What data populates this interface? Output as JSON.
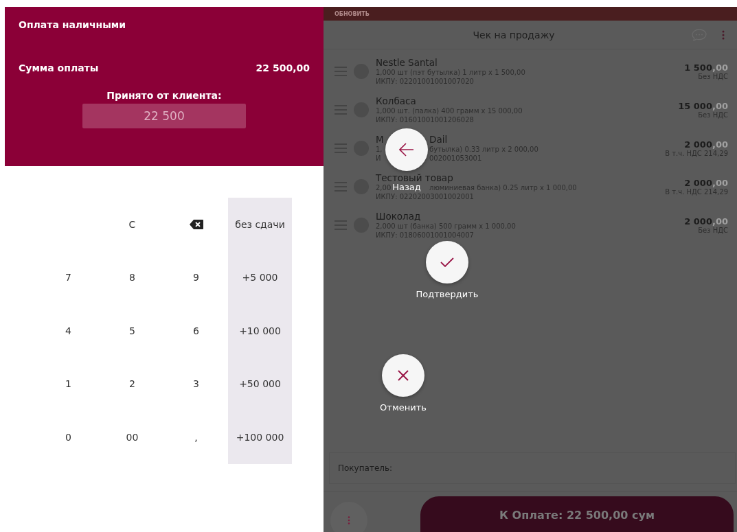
{
  "payment": {
    "title": "Оплата наличными",
    "sum_label": "Сумма оплаты",
    "sum_value": "22 500,00",
    "received_label": "Принято от клиента:",
    "received_value": "22 500"
  },
  "keypad": [
    {
      "kind": "blank"
    },
    {
      "kind": "key",
      "label": "C"
    },
    {
      "kind": "backspace"
    },
    {
      "kind": "quick",
      "label": "без сдачи"
    },
    {
      "kind": "key",
      "label": "7"
    },
    {
      "kind": "key",
      "label": "8"
    },
    {
      "kind": "key",
      "label": "9"
    },
    {
      "kind": "quick",
      "label": "+5 000"
    },
    {
      "kind": "key",
      "label": "4"
    },
    {
      "kind": "key",
      "label": "5"
    },
    {
      "kind": "key",
      "label": "6"
    },
    {
      "kind": "quick",
      "label": "+10 000"
    },
    {
      "kind": "key",
      "label": "1"
    },
    {
      "kind": "key",
      "label": "2"
    },
    {
      "kind": "key",
      "label": "3"
    },
    {
      "kind": "quick",
      "label": "+50 000"
    },
    {
      "kind": "key",
      "label": "0"
    },
    {
      "kind": "key",
      "label": "00"
    },
    {
      "kind": "key",
      "label": ","
    },
    {
      "kind": "quick",
      "label": "+100 000"
    }
  ],
  "receipt": {
    "refresh": "ОБНОВИТЬ",
    "title": "Чек на продажу",
    "items": [
      {
        "name": [
          "Nestle Santal"
        ],
        "detail": [
          "1,000 шт (пэт бутылка) 1 литр x 1 500,00"
        ],
        "code": [
          "ИКПУ: 02201001001007020"
        ],
        "amount": "1 500",
        "cents": ",00",
        "vat": "Без НДС"
      },
      {
        "name": [
          "Колбаса"
        ],
        "detail": [
          "1,000 шт. (палка) 400 грамм x 15 000,00"
        ],
        "code": [
          "ИКПУ: 01601001001206028"
        ],
        "amount": "15 000",
        "cents": ",00",
        "vat": "Без НДС"
      },
      {
        "name": [
          "M",
          "Dail"
        ],
        "detail": [
          "1,",
          "бутылка) 0.33 литр x 2 000,00"
        ],
        "code": [
          "И",
          "002001053001"
        ],
        "amount": "2 000",
        "cents": ",00",
        "vat": "В т.ч. НДС 214,29"
      },
      {
        "name": [
          "Тестовый товар"
        ],
        "detail": [
          "2,00",
          "люминиевая банка) 0.25 литр x 1 000,00"
        ],
        "code": [
          "ИКПУ: 02202003001002001"
        ],
        "amount": "2 000",
        "cents": ",00",
        "vat": "В т.ч. НДС 214,29"
      },
      {
        "name": [
          "Шоколад"
        ],
        "detail": [
          "2,000 шт (банка) 500 грамм x 1 000,00"
        ],
        "code": [
          "ИКПУ: 01806001001004007"
        ],
        "amount": "2 000",
        "cents": ",00",
        "vat": "Без НДС"
      }
    ],
    "customer_label": "Покупатель:",
    "pay_button": "К Оплате: 22 500,00 сум"
  },
  "actions": [
    {
      "kind": "back",
      "label": "Назад"
    },
    {
      "kind": "confirm",
      "label": "Подтвердить"
    },
    {
      "kind": "cancel",
      "label": "Отменить"
    }
  ]
}
